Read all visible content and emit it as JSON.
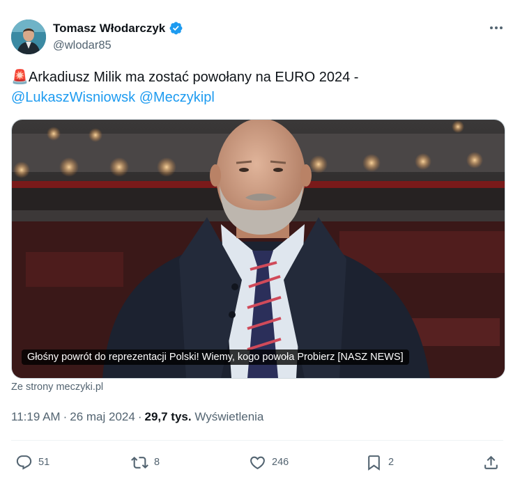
{
  "author": {
    "name": "Tomasz Włodarczyk",
    "handle": "@wlodar85"
  },
  "tweet": {
    "emoji": "🚨",
    "text": "Arkadiusz Milik ma zostać powołany na EURO 2024 -",
    "mentions": [
      "@LukaszWisniowsk",
      "@Meczykipl"
    ]
  },
  "card": {
    "caption": "Głośny powrót do reprezentacji Polski! Wiemy, kogo powoła Probierz [NASZ NEWS]",
    "source": "Ze strony meczyki.pl"
  },
  "meta": {
    "time": "11:19 AM",
    "date": "26 maj 2024",
    "views_count": "29,7 tys.",
    "views_label": "Wyświetlenia"
  },
  "actions": {
    "replies": "51",
    "reposts": "8",
    "likes": "246",
    "bookmarks": "2"
  },
  "colors": {
    "accent": "#1d9bf0",
    "secondary_text": "#536471",
    "primary_text": "#0f1419"
  },
  "icons": [
    "verified-badge-icon",
    "more-icon",
    "siren-emoji",
    "reply-icon",
    "repost-icon",
    "like-icon",
    "bookmark-icon",
    "share-icon"
  ]
}
